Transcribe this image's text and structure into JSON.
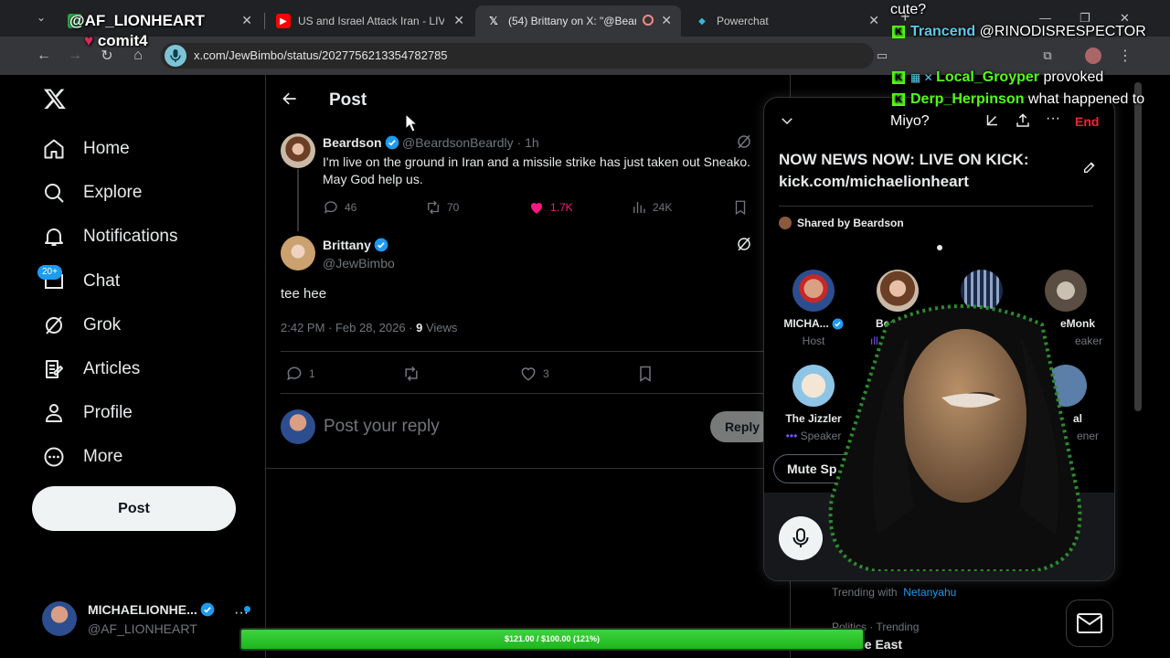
{
  "browser": {
    "tabs": [
      {
        "title": "",
        "icon": "green-tab-icon"
      },
      {
        "title": "US and Israel Attack Iran - LIVE",
        "icon": "youtube-icon"
      },
      {
        "title": "(54) Brittany on X: \"@Beard",
        "icon": "x-icon"
      },
      {
        "title": "Powerchat",
        "icon": "powerchat-icon"
      }
    ],
    "new_tab": "+",
    "url": "x.com/JewBimbo/status/2027756213354782785"
  },
  "nav": {
    "items": [
      {
        "label": "Home",
        "icon": "home-icon"
      },
      {
        "label": "Explore",
        "icon": "search-icon"
      },
      {
        "label": "Notifications",
        "icon": "bell-icon"
      },
      {
        "label": "Chat",
        "icon": "chat-icon"
      },
      {
        "label": "Grok",
        "icon": "grok-icon"
      },
      {
        "label": "Articles",
        "icon": "articles-icon"
      },
      {
        "label": "Profile",
        "icon": "person-icon"
      },
      {
        "label": "More",
        "icon": "more-circle-icon"
      }
    ],
    "chat_badge": "20+",
    "post_button": "Post",
    "account": {
      "name": "MICHAELIONHE...",
      "handle": "@AF_LIONHEART"
    }
  },
  "post_page": {
    "title": "Post",
    "parent_tweet": {
      "name": "Beardson",
      "handle": "@BeardsonBeardly",
      "time": "· 1h",
      "text": "I'm live on the ground in Iran and a missile strike has just taken out Sneako. May God help us.",
      "replies": "46",
      "reposts": "70",
      "likes": "1.7K",
      "views": "24K"
    },
    "main_tweet": {
      "name": "Brittany",
      "handle": "@JewBimbo",
      "text": "tee hee",
      "timestamp": "2:42 PM · Feb 28, 2026 · ",
      "views_count": "9",
      "views_label": " Views",
      "replies": "1",
      "likes": "3"
    },
    "reply_placeholder": "Post your reply",
    "reply_button": "Reply"
  },
  "space": {
    "title": "NOW NEWS NOW: LIVE ON KICK: kick.com/michaelionheart",
    "end_label": "End",
    "shared_by": "Shared by Beardson",
    "speakers": [
      {
        "name": "MICHA...",
        "role": "Host"
      },
      {
        "name": "Beardso",
        "role": "Sp"
      },
      {
        "name": "",
        "role": ""
      },
      {
        "name": "eMonk",
        "role": "eaker"
      },
      {
        "name": "The Jizzler",
        "role": "Speaker"
      },
      {
        "name": "al",
        "role": "ener"
      }
    ],
    "mute_button": "Mute Sp"
  },
  "right": {
    "trending_with_label": "Trending with",
    "trending_with_topic": "Netanyahu",
    "category": "Politics · Trending",
    "topic": "lle East"
  },
  "overlay": {
    "top_user": "@AF_LIONHEART",
    "top_sub": "comit4",
    "chat": [
      {
        "text": "cute?"
      },
      {
        "user": "Trancend",
        "text": "@RINODISRESPECTOR"
      },
      {
        "user": "Local_Groyper",
        "text": "provoked"
      },
      {
        "user": "Derp_Herpinson",
        "text": "what happened to"
      },
      {
        "text": "Miyo?"
      }
    ],
    "goal_text": "$121.00 / $100.00 (121%)",
    "goal_fraction": 1.0
  },
  "colors": {
    "accent": "#1d9bf0",
    "like": "#f91880",
    "kick_green": "#53fc18",
    "end_red": "#f4212e"
  }
}
